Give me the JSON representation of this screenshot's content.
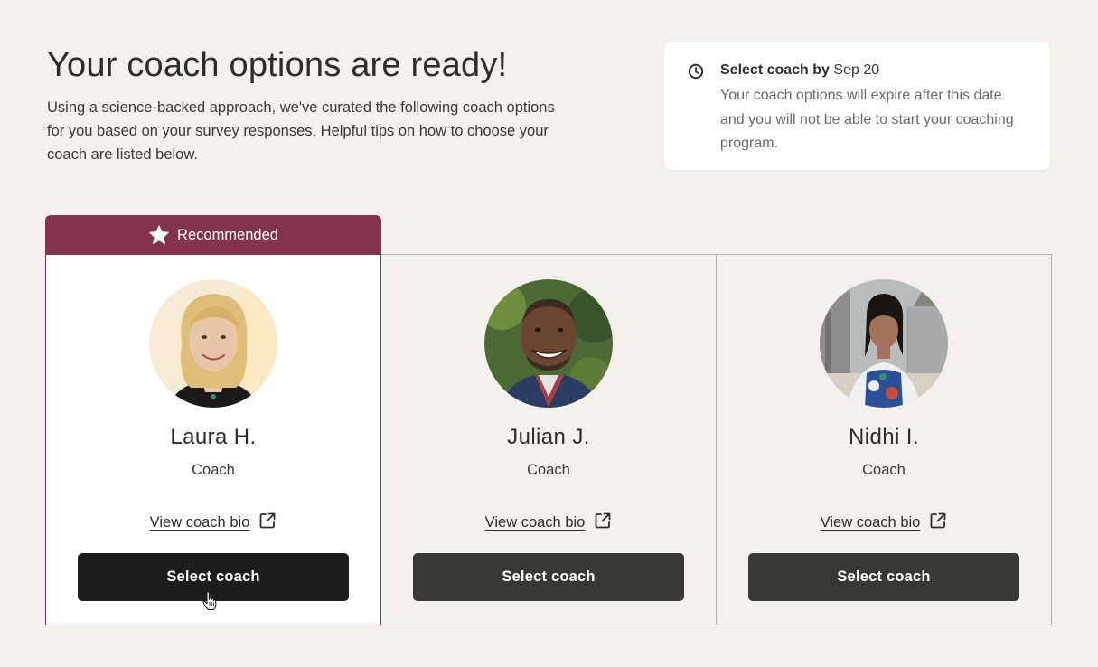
{
  "header": {
    "title": "Your coach options are ready!",
    "description": "Using a science-backed approach, we've curated the following coach options for you based on your survey responses. Helpful tips on how to choose your coach are listed below."
  },
  "expiry": {
    "icon": "clock-icon",
    "title_bold": "Select coach by",
    "date": "Sep 20",
    "body": "Your coach options will expire after this date and you will not be able to start your coaching program."
  },
  "badge": {
    "icon": "star-icon",
    "label": "Recommended"
  },
  "coaches": [
    {
      "name": "Laura H.",
      "role": "Coach",
      "bio_link": "View coach bio",
      "button": "Select coach",
      "recommended": true
    },
    {
      "name": "Julian J.",
      "role": "Coach",
      "bio_link": "View coach bio",
      "button": "Select coach",
      "recommended": false
    },
    {
      "name": "Nidhi I.",
      "role": "Coach",
      "bio_link": "View coach bio",
      "button": "Select coach",
      "recommended": false
    }
  ],
  "colors": {
    "background": "#f4f0ec",
    "accent": "#84334f",
    "button": "#3a3832",
    "button_active": "#1e1d1b",
    "card": "#ffffff"
  }
}
